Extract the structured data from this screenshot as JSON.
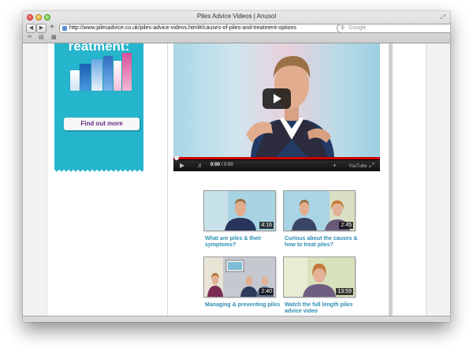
{
  "window": {
    "title": "Piles Advice Videos | Anusol"
  },
  "toolbar": {
    "back_icon": "back-arrow-icon",
    "forward_icon": "forward-arrow-icon",
    "add_icon": "plus-icon",
    "url": "http://www.pilesadvice.co.uk/piles-advice-videos.html#/causes-of-piles-and-treatment-options",
    "search_placeholder": "Google"
  },
  "promo": {
    "headline": "reatment:",
    "button_label": "Find out more",
    "colors": {
      "panel": "#25b5cc",
      "button_text": "#6a2b8a"
    }
  },
  "player": {
    "time_current": "0:00",
    "time_total": "/ 0:00",
    "brand": "YouTube",
    "colors": {
      "progress": "#cc0000"
    }
  },
  "videos": [
    {
      "caption": "What are piles & their symptoms?",
      "duration": "4:16"
    },
    {
      "caption": "Curious about the causes & how to treat piles?",
      "duration": "2:45"
    },
    {
      "caption": "Managing & preventing piles",
      "duration": "2:40"
    },
    {
      "caption": "Watch the full length piles advice video",
      "duration": "13:59"
    }
  ],
  "colors": {
    "caption": "#2b8db3"
  }
}
